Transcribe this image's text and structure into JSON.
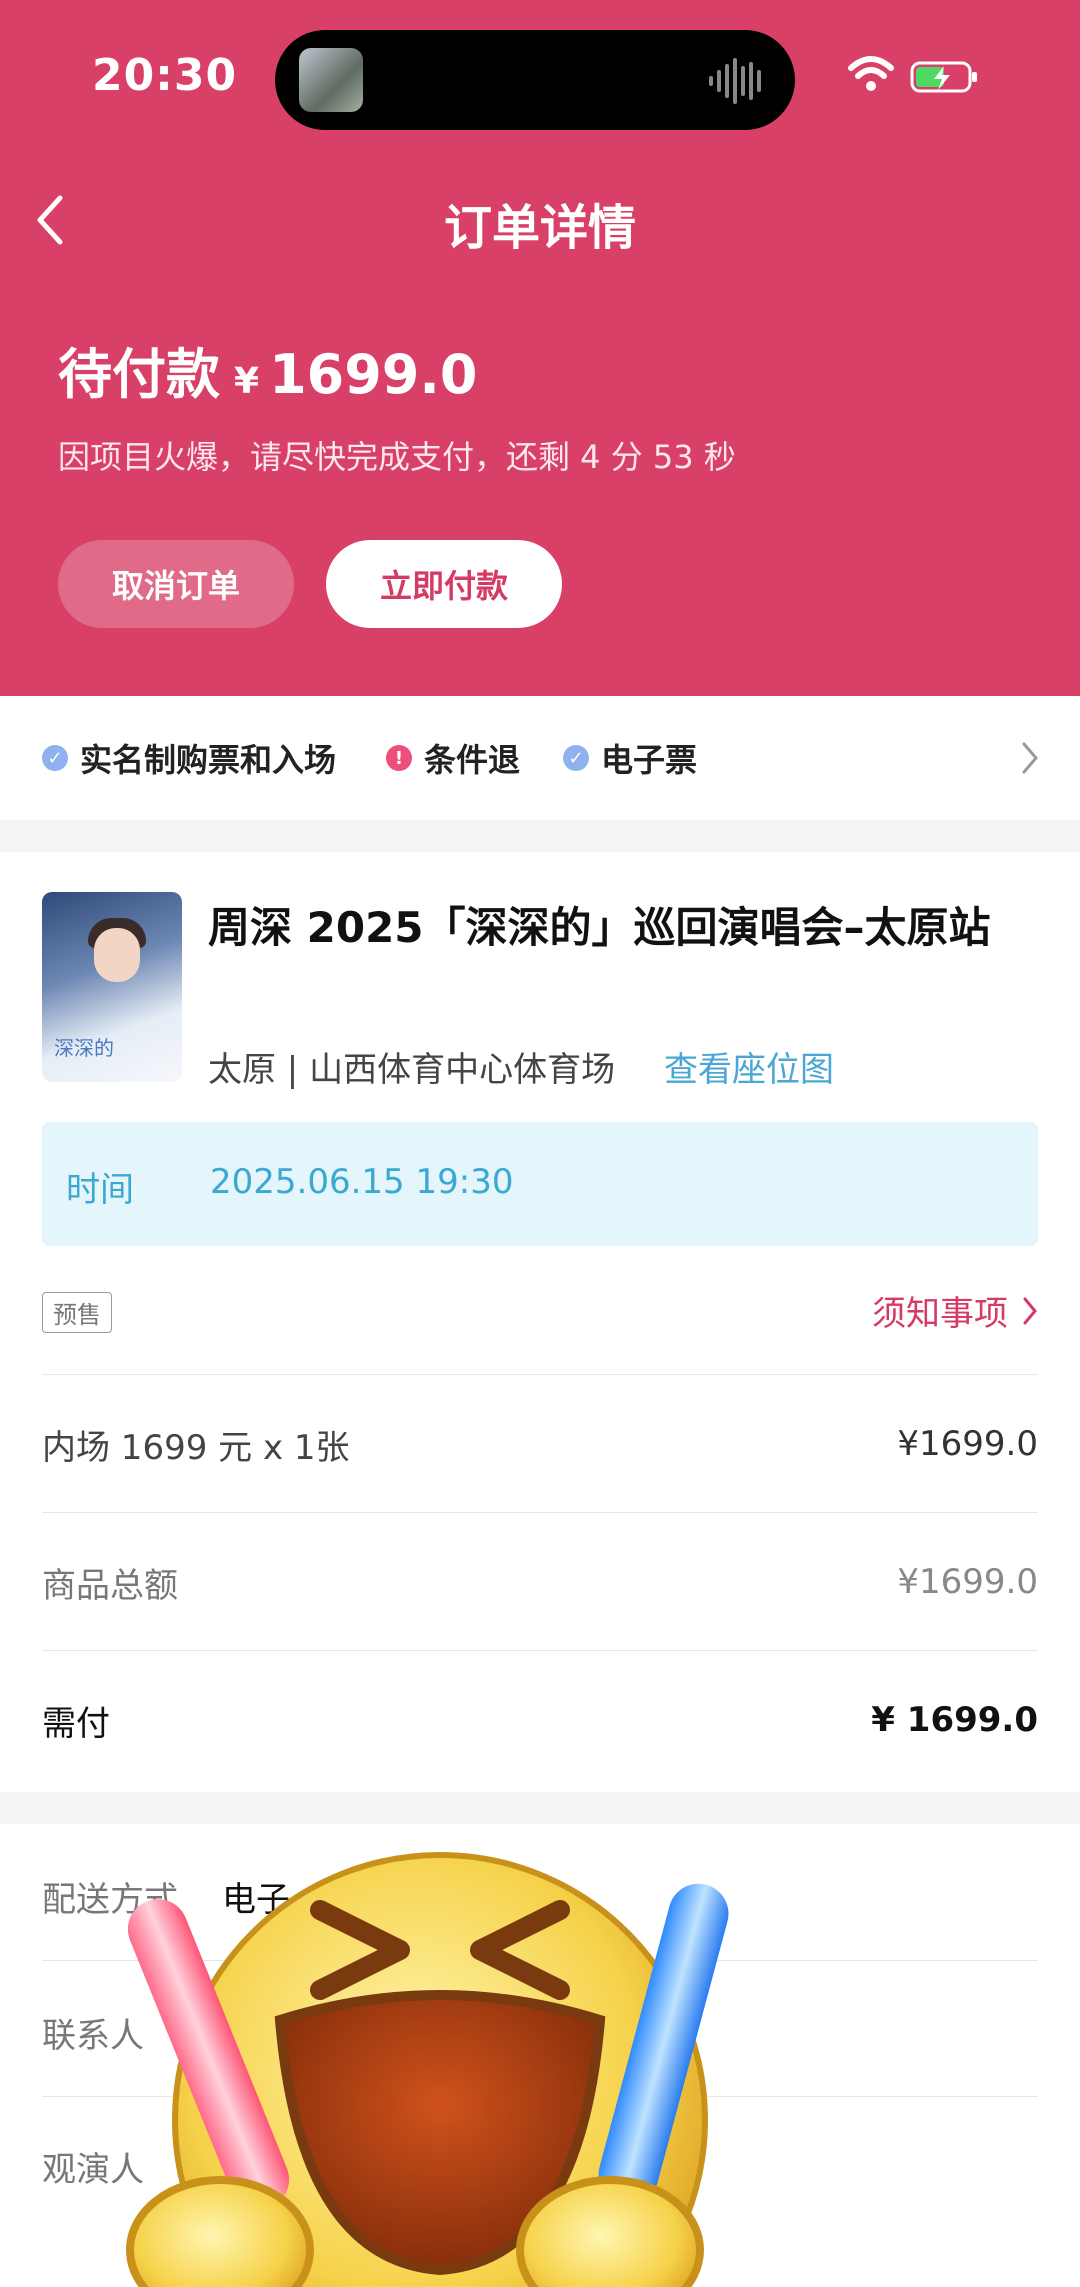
{
  "status_bar": {
    "time": "20:30"
  },
  "nav": {
    "title": "订单详情"
  },
  "order_status": {
    "label": "待付款",
    "currency": "¥",
    "amount": "1699.0",
    "countdown": "因项目火爆，请尽快完成支付，还剩 4 分 53 秒"
  },
  "actions": {
    "cancel": "取消订单",
    "pay": "立即付款"
  },
  "features": [
    {
      "label": "实名制购票和入场",
      "icon": "check-icon"
    },
    {
      "label": "条件退",
      "icon": "warning-icon"
    },
    {
      "label": "电子票",
      "icon": "check-icon"
    }
  ],
  "event": {
    "title": "周深 2025「深深的」巡回演唱会–太原站",
    "venue": "太原 | 山西体育中心体育场",
    "seat_map_link": "查看座位图",
    "poster_text": "深深的",
    "time_label": "时间",
    "time_value": "2025.06.15 19:30",
    "tag": "预售",
    "notice_link": "须知事项"
  },
  "line_items": [
    {
      "label": "内场 1699 元 x 1张",
      "value": "¥1699.0"
    },
    {
      "label": "商品总额",
      "value": "¥1699.0"
    },
    {
      "label": "需付",
      "value": "¥ 1699.0"
    }
  ],
  "info": {
    "delivery_label": "配送方式",
    "delivery_value": "电子",
    "contact_label": "联系人",
    "attendee_label": "观演人"
  },
  "colors": {
    "brand": "#d94068",
    "link": "#4aa7d3",
    "accent_pink": "#d43a64"
  }
}
